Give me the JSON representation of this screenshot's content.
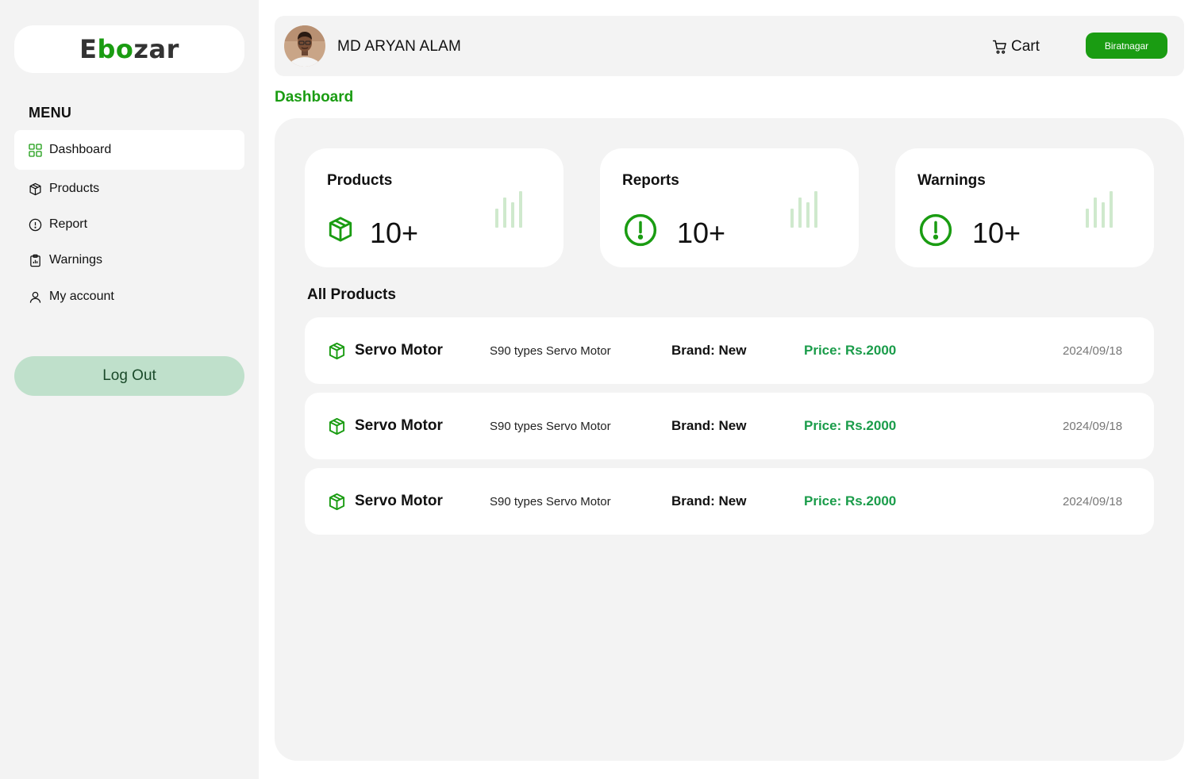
{
  "brand": {
    "logo_prefix": "E",
    "logo_accent": "bo",
    "logo_suffix": "zar",
    "accent_color": "#1a9c12"
  },
  "sidebar": {
    "menu_heading": "MENU",
    "items": [
      {
        "label": "Dashboard",
        "icon": "grid-icon",
        "active": true
      },
      {
        "label": "Products",
        "icon": "box-icon",
        "active": false
      },
      {
        "label": "Report",
        "icon": "alert-circle-icon",
        "active": false
      },
      {
        "label": "Warnings",
        "icon": "clipboard-chart-icon",
        "active": false
      },
      {
        "label": "My account",
        "icon": "user-icon",
        "active": false
      }
    ],
    "logout_label": "Log Out"
  },
  "header": {
    "user_name": "MD ARYAN ALAM",
    "cart_label": "Cart",
    "location_label": "Biratnagar"
  },
  "page_title": "Dashboard",
  "stats": [
    {
      "title": "Products",
      "value": "10+",
      "icon": "box-icon"
    },
    {
      "title": "Reports",
      "value": "10+",
      "icon": "alert-circle-icon"
    },
    {
      "title": "Warnings",
      "value": "10+",
      "icon": "alert-circle-icon"
    }
  ],
  "products_section": {
    "title": "All Products",
    "rows": [
      {
        "name": "Servo Motor",
        "description": "S90 types Servo Motor",
        "brand": "Brand: New",
        "price": "Price: Rs.2000",
        "date": "2024/09/18"
      },
      {
        "name": "Servo Motor",
        "description": "S90 types Servo Motor",
        "brand": "Brand: New",
        "price": "Price: Rs.2000",
        "date": "2024/09/18"
      },
      {
        "name": "Servo Motor",
        "description": "S90 types Servo Motor",
        "brand": "Brand: New",
        "price": "Price: Rs.2000",
        "date": "2024/09/18"
      }
    ]
  }
}
